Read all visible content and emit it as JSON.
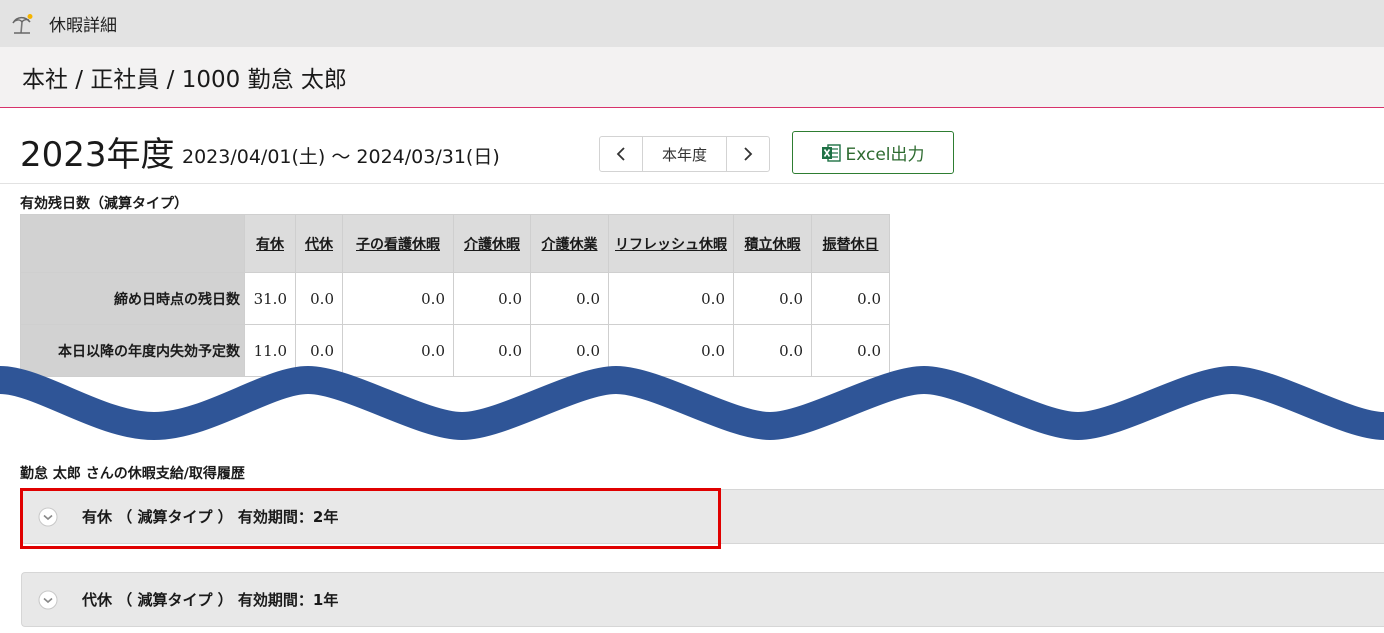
{
  "app": {
    "title": "休暇詳細",
    "icon": "palm-tree-icon"
  },
  "breadcrumb": "本社 / 正社員 / 1000 勤怠 太郎",
  "year": {
    "label": "2023年度",
    "range": "2023/04/01(土) ～ 2024/03/31(日)",
    "prev_icon": "chevron-left-icon",
    "current_label": "本年度",
    "next_icon": "chevron-right-icon"
  },
  "export": {
    "label": "Excel出力",
    "icon": "excel-icon",
    "color": "#2e7d32"
  },
  "balance": {
    "title": "有効残日数（減算タイプ）",
    "columns": [
      "有休",
      "代休",
      "子の看護休暇",
      "介護休暇",
      "介護休業",
      "リフレッシュ休暇",
      "積立休暇",
      "振替休日"
    ],
    "rows": [
      {
        "label": "締め日時点の残日数",
        "values": [
          "31.0",
          "0.0",
          "0.0",
          "0.0",
          "0.0",
          "0.0",
          "0.0",
          "0.0"
        ]
      },
      {
        "label": "本日以降の年度内失効予定数",
        "values": [
          "11.0",
          "0.0",
          "0.0",
          "0.0",
          "0.0",
          "0.0",
          "0.0",
          "0.0"
        ]
      }
    ]
  },
  "history": {
    "title": "勤怠 太郎 さんの休暇支給/取得履歴",
    "items": [
      {
        "label": "有休 （ 減算タイプ ） 有効期間：2年"
      },
      {
        "label": "代休 （ 減算タイプ ） 有効期間：1年"
      }
    ]
  },
  "colors": {
    "highlight": "#e00000",
    "wave": "#2f5597",
    "accent_line": "#d7326b"
  }
}
